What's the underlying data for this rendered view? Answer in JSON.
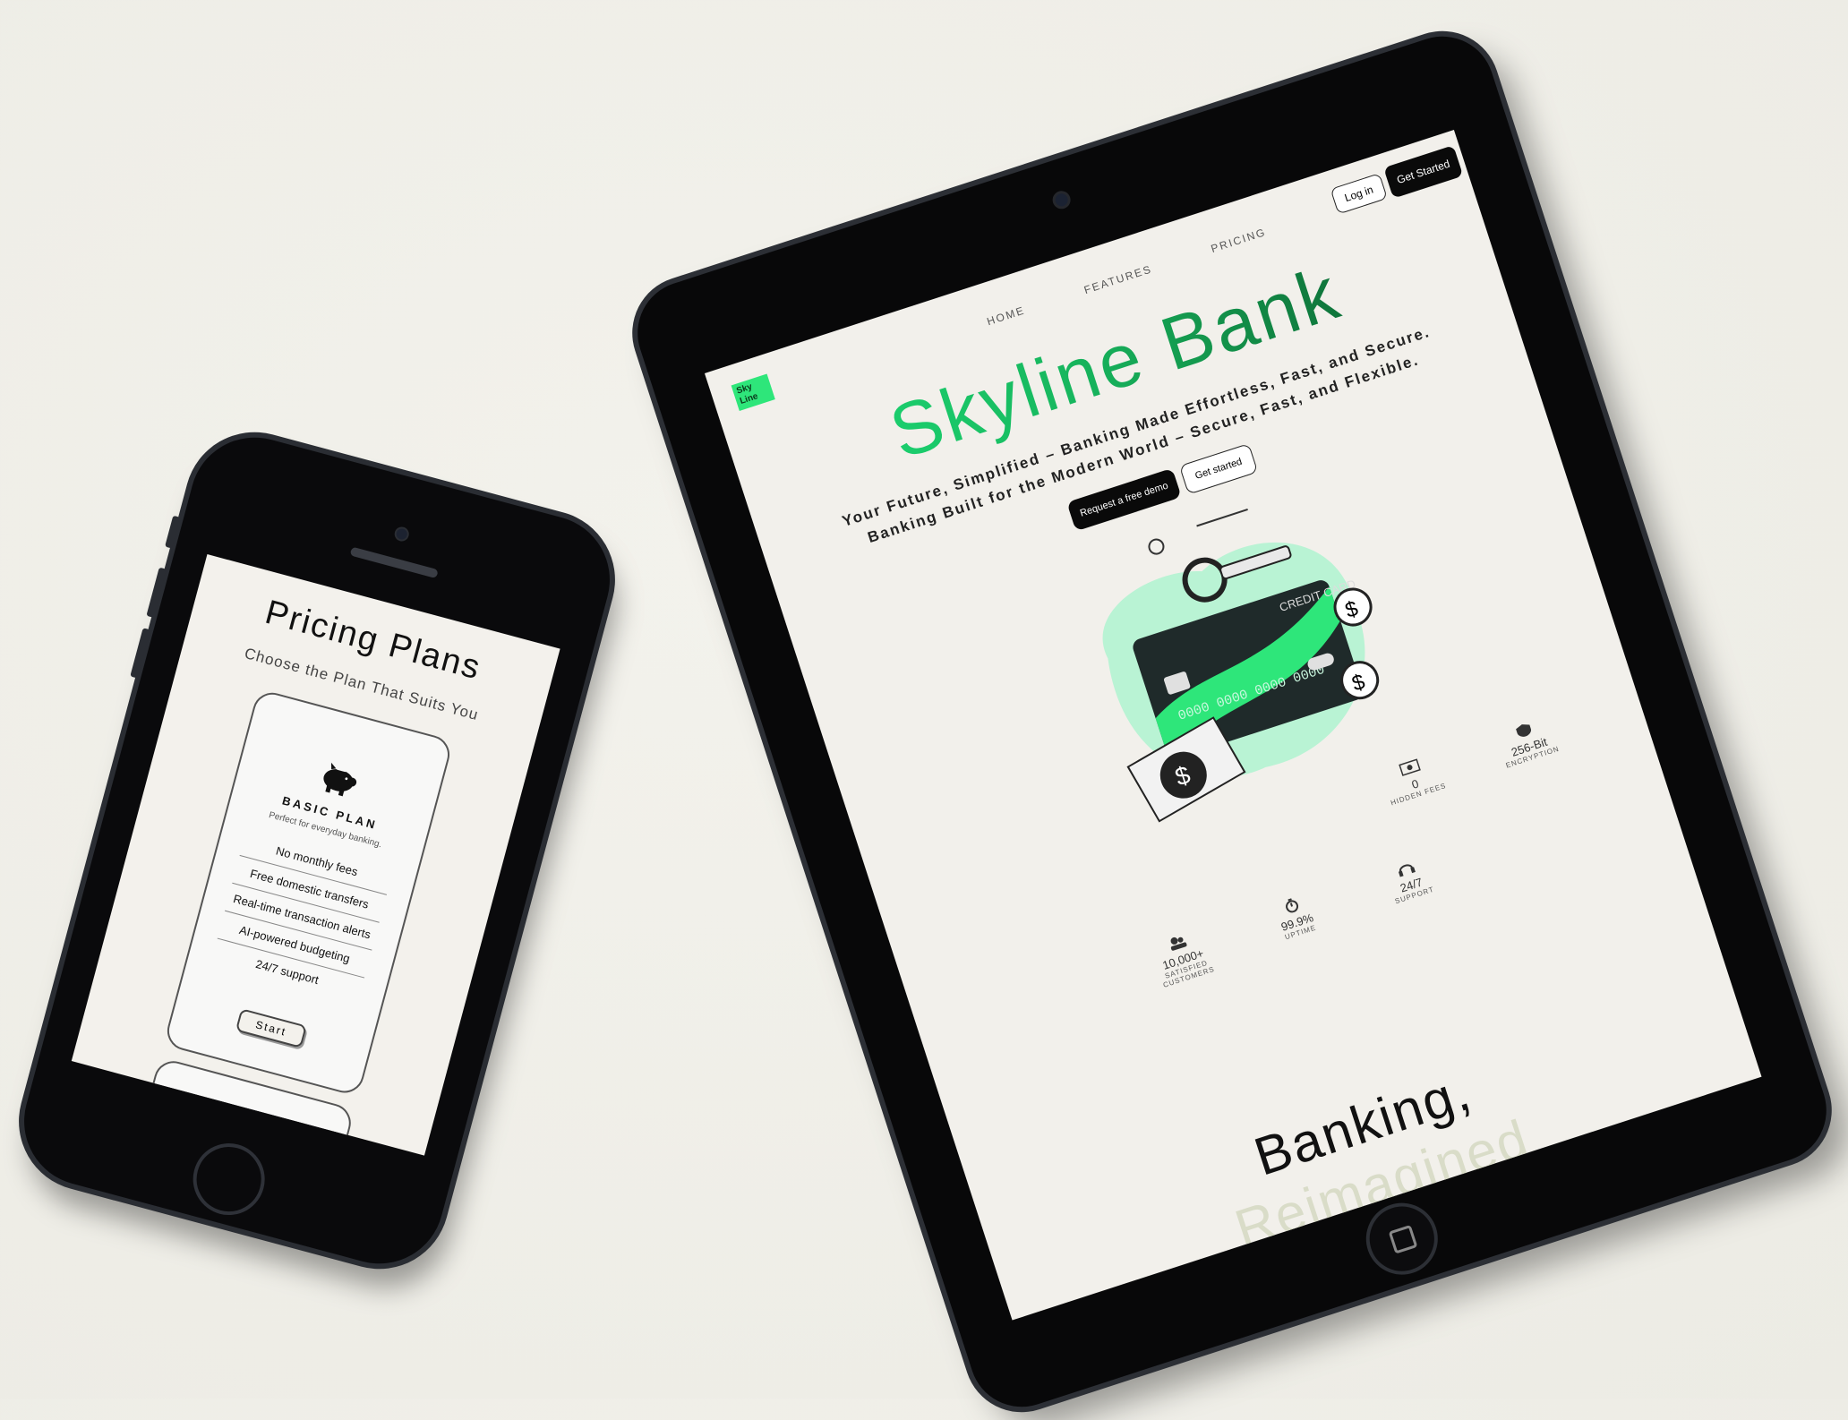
{
  "phone": {
    "title": "Pricing Plans",
    "subtitle": "Choose the Plan That Suits You",
    "plan": {
      "icon": "piggy-bank-icon",
      "name": "BASIC PLAN",
      "description": "Perfect for everyday banking.",
      "features": [
        "No monthly fees",
        "Free domestic transfers",
        "Real-time transaction alerts",
        "AI-powered budgeting",
        "24/7 support"
      ],
      "button_label": "Start"
    }
  },
  "tablet": {
    "logo_text": "Sky Line",
    "nav": [
      "HOME",
      "FEATURES",
      "PRICING"
    ],
    "login_label": "Log in",
    "get_started_top_label": "Get Started",
    "hero_title": "Skyline Bank",
    "tagline_1": "Your Future, Simplified – Banking Made Effortless, Fast, and Secure.",
    "tagline_2": "Banking Built for the Modern World – Secure, Fast, and Flexible.",
    "demo_label": "Request a free demo",
    "get_started_label": "Get started",
    "card_label": "CREDIT CARD",
    "card_number": "0000 0000 0000 0000",
    "stats_row1": [
      {
        "icon": "cash-icon",
        "value": "0",
        "label": "HIDDEN FEES"
      },
      {
        "icon": "shield-icon",
        "value": "256-Bit",
        "label": "ENCRYPTION"
      }
    ],
    "stats_row2": [
      {
        "icon": "users-icon",
        "value": "10,000+",
        "label": "SATISFIED CUSTOMERS"
      },
      {
        "icon": "stopwatch-icon",
        "value": "99.9%",
        "label": "UPTIME"
      },
      {
        "icon": "headset-icon",
        "value": "24/7",
        "label": "SUPPORT"
      }
    ],
    "section_title_line1": "Banking,",
    "section_title_line2": "Reimagined",
    "colors": {
      "accent": "#2ee67a",
      "accent_dark": "#0b4f27",
      "screen_bg": "#f2f0eb"
    }
  }
}
